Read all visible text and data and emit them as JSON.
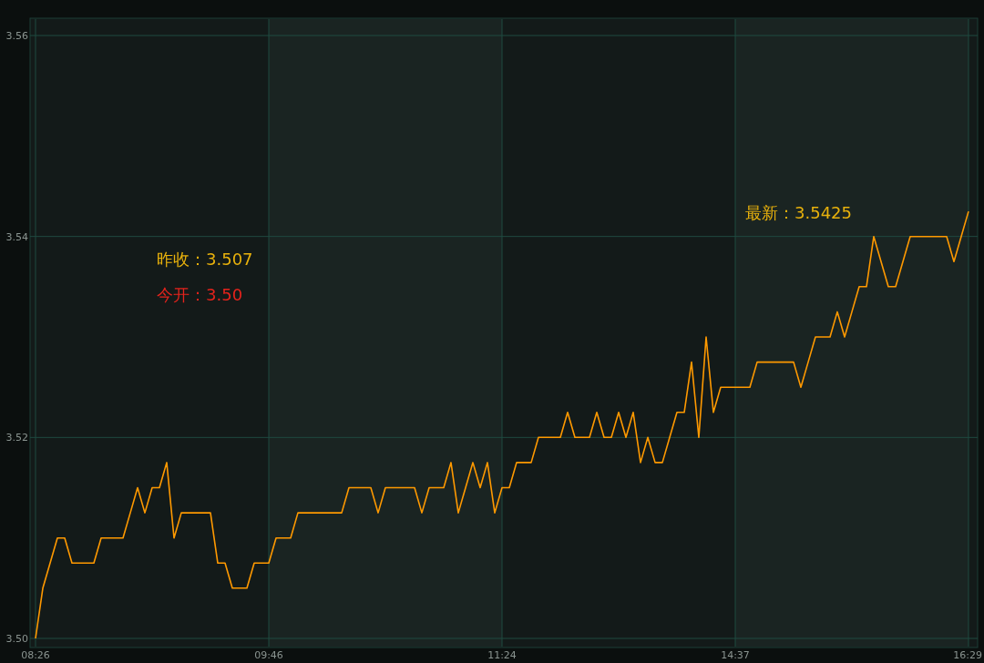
{
  "chart_data": {
    "type": "line",
    "ylim": [
      3.5,
      3.56
    ],
    "categories": [
      "08:26",
      null,
      null,
      null,
      null,
      null,
      null,
      null,
      null,
      null,
      null,
      null,
      null,
      null,
      null,
      null,
      null,
      null,
      null,
      null,
      null,
      null,
      null,
      null,
      null,
      null,
      null,
      null,
      null,
      null,
      null,
      null,
      "09:46",
      null,
      null,
      null,
      null,
      null,
      null,
      null,
      null,
      null,
      null,
      null,
      null,
      null,
      null,
      null,
      null,
      null,
      null,
      null,
      null,
      null,
      null,
      null,
      null,
      null,
      null,
      null,
      null,
      null,
      null,
      null,
      "11:24",
      null,
      null,
      null,
      null,
      null,
      null,
      null,
      null,
      null,
      null,
      null,
      null,
      null,
      null,
      null,
      null,
      null,
      null,
      null,
      null,
      null,
      null,
      null,
      null,
      null,
      null,
      null,
      null,
      null,
      null,
      null,
      "14:37",
      null,
      null,
      null,
      null,
      null,
      null,
      null,
      null,
      null,
      null,
      null,
      null,
      null,
      null,
      null,
      null,
      null,
      null,
      null,
      null,
      null,
      null,
      null,
      null,
      null,
      null,
      null,
      null,
      null,
      null,
      null,
      "16:29"
    ],
    "yticks": [
      {
        "value": 3.5,
        "label": "3.50"
      },
      {
        "value": 3.52,
        "label": "3.52"
      },
      {
        "value": 3.54,
        "label": "3.54"
      },
      {
        "value": 3.56,
        "label": "3.56"
      }
    ],
    "series": [
      {
        "color": "#ff9900",
        "values": [
          3.5,
          3.505,
          3.5075,
          3.51,
          3.51,
          3.5075,
          3.5075,
          3.5075,
          3.5075,
          3.51,
          3.51,
          3.51,
          3.51,
          3.5125,
          3.515,
          3.5125,
          3.515,
          3.515,
          3.5175,
          3.51,
          3.5125,
          3.5125,
          3.5125,
          3.5125,
          3.5125,
          3.5075,
          3.5075,
          3.505,
          3.505,
          3.505,
          3.5075,
          3.5075,
          3.5075,
          3.51,
          3.51,
          3.51,
          3.5125,
          3.5125,
          3.5125,
          3.5125,
          3.5125,
          3.5125,
          3.5125,
          3.515,
          3.515,
          3.515,
          3.515,
          3.5125,
          3.515,
          3.515,
          3.515,
          3.515,
          3.515,
          3.5125,
          3.515,
          3.515,
          3.515,
          3.5175,
          3.5125,
          3.515,
          3.5175,
          3.515,
          3.5175,
          3.5125,
          3.515,
          3.515,
          3.5175,
          3.5175,
          3.5175,
          3.52,
          3.52,
          3.52,
          3.52,
          3.5225,
          3.52,
          3.52,
          3.52,
          3.5225,
          3.52,
          3.52,
          3.5225,
          3.52,
          3.5225,
          3.5175,
          3.52,
          3.5175,
          3.5175,
          3.52,
          3.5225,
          3.5225,
          3.5275,
          3.52,
          3.53,
          3.5225,
          3.525,
          3.525,
          3.525,
          3.525,
          3.525,
          3.5275,
          3.5275,
          3.5275,
          3.5275,
          3.5275,
          3.5275,
          3.525,
          3.5275,
          3.53,
          3.53,
          3.53,
          3.5325,
          3.53,
          3.5325,
          3.535,
          3.535,
          3.54,
          3.5375,
          3.535,
          3.535,
          3.5375,
          3.54,
          3.54,
          3.54,
          3.54,
          3.54,
          3.54,
          3.5375,
          3.54,
          3.5425
        ]
      }
    ]
  },
  "price_labels": [
    {
      "text": "昨收：3.507",
      "color": "#e8b10c"
    },
    {
      "text": "今开：3.50",
      "color": "#e4231c"
    },
    {
      "text": "最新：3.5425",
      "color": "#e8b10c"
    }
  ]
}
